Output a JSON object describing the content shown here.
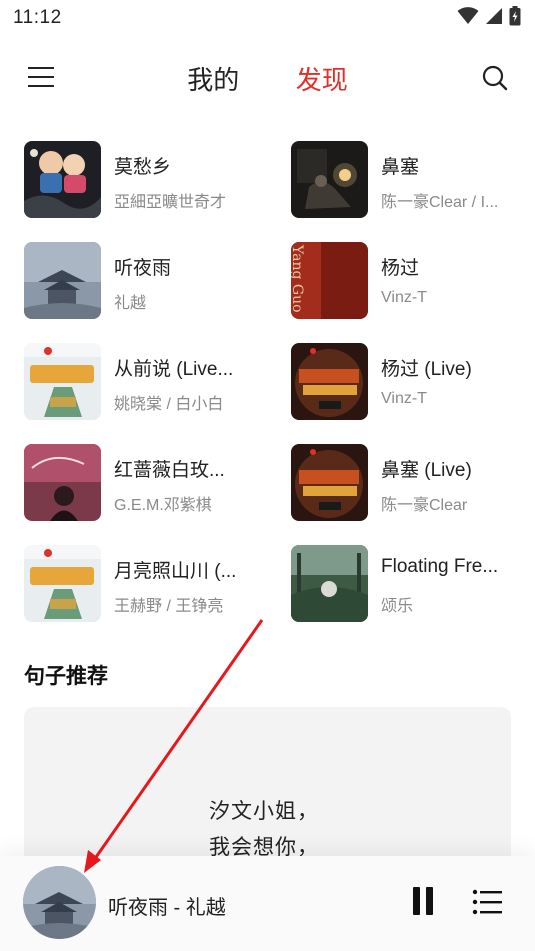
{
  "status_bar": {
    "time": "11:12"
  },
  "nav": {
    "tabs": [
      "我的",
      "发现"
    ],
    "active_tab": "发现"
  },
  "songs": [
    {
      "title": "莫愁乡",
      "artist": "亞細亞曠世奇才",
      "cover": "cartoon-people"
    },
    {
      "title": "鼻塞",
      "artist": "陈一豪Clear / I...",
      "cover": "dark-room"
    },
    {
      "title": "听夜雨",
      "artist": "礼越",
      "cover": "pagoda-rain"
    },
    {
      "title": "杨过",
      "artist": "Vinz-T",
      "cover": "yang-guo-red",
      "cover_text": "Yang Guo"
    },
    {
      "title": "从前说 (Live...",
      "artist": "姚晓棠 / 白小白",
      "cover": "voice-show"
    },
    {
      "title": "杨过 (Live)",
      "artist": "Vinz-T",
      "cover": "rap-china"
    },
    {
      "title": "红蔷薇白玫...",
      "artist": "G.E.M.邓紫棋",
      "cover": "gloria"
    },
    {
      "title": "鼻塞 (Live)",
      "artist": "陈一豪Clear",
      "cover": "rap-china"
    },
    {
      "title": "月亮照山川 (...",
      "artist": "王赫野 / 王铮亮",
      "cover": "voice-show"
    },
    {
      "title": "Floating Fre...",
      "artist": "颂乐",
      "cover": "garden"
    }
  ],
  "quotes": {
    "section_title": "句子推荐",
    "lines": [
      "汐文小姐，",
      "我会想你，"
    ]
  },
  "player": {
    "now_playing": "听夜雨 - 礼越"
  },
  "colors": {
    "accent": "#e0302a",
    "annotation_arrow": "#e5191c"
  }
}
